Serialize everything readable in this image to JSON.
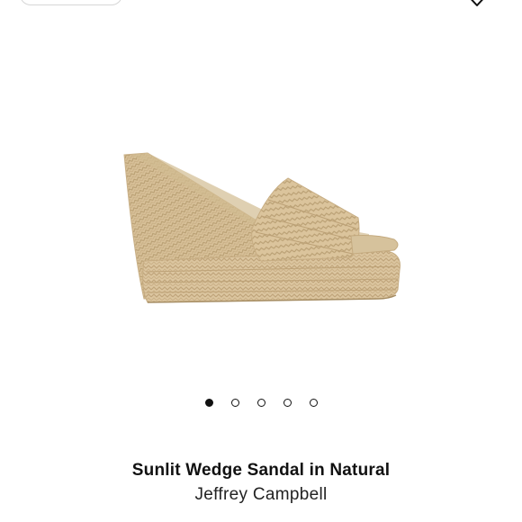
{
  "product": {
    "title": "Sunlit Wedge Sandal in Natural",
    "brand": "Jeffrey Campbell",
    "image_icon": "espadrille-wedge-sandal"
  },
  "carousel": {
    "count": 5,
    "active_index": 0
  },
  "icons": {
    "wishlist": "heart-icon"
  },
  "colors": {
    "text": "#111111",
    "jute": "#d9c39a",
    "jute_dark": "#b9a074"
  }
}
